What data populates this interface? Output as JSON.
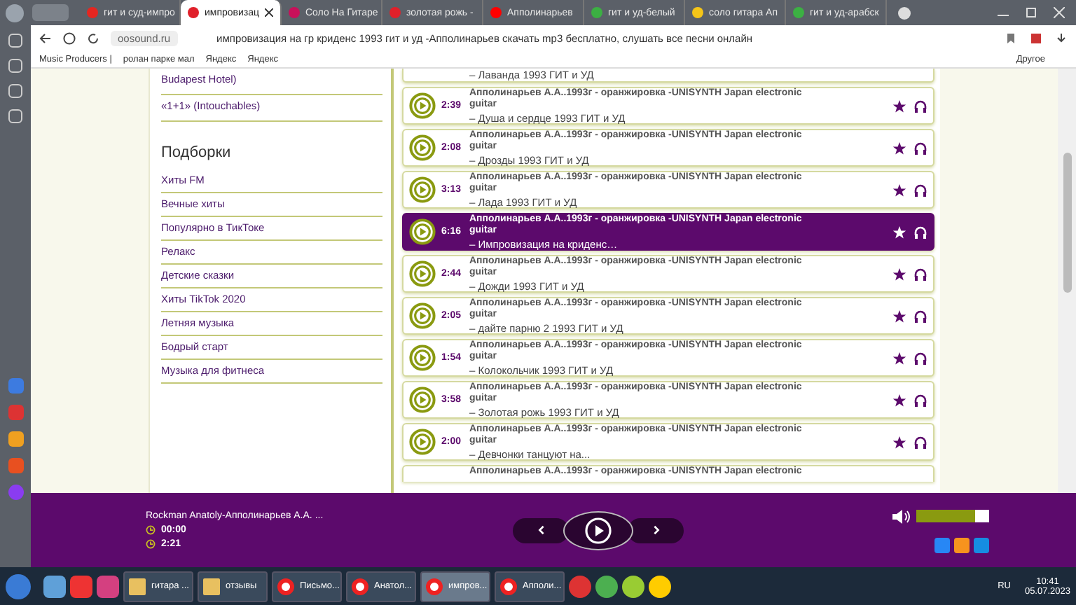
{
  "browser": {
    "tabs": [
      {
        "label": "гит и суд-импро",
        "selected": false,
        "color": "#e52620"
      },
      {
        "label": "импровизац",
        "selected": true,
        "color": "#e0202a"
      },
      {
        "label": "Соло На Гитаре",
        "selected": false,
        "color": "#c8105a"
      },
      {
        "label": "золотая рожь -",
        "selected": false,
        "color": "#e0202a"
      },
      {
        "label": "Апполинарьев",
        "selected": false,
        "color": "#ff0000"
      },
      {
        "label": "гит и уд-белый",
        "selected": false,
        "color": "#3cb043"
      },
      {
        "label": "соло гитара Ап",
        "selected": false,
        "color": "#f5c518"
      },
      {
        "label": "гит и уд-арабск",
        "selected": false,
        "color": "#3cb043"
      }
    ],
    "address": "oosound.ru",
    "page_title": "импровизация на гр криденс 1993 гит и уд -Апполинарьев скачать mp3 бесплатно, слушать все песни онлайн",
    "bookmarks": [
      "Music Producers |",
      "ролан парке мал",
      "Яндекс",
      "Яндекс"
    ],
    "bookmarks_other": "Другое"
  },
  "sidebar": {
    "film_items": [
      "Budapest Hotel)",
      "«1+1» (Intouchables)"
    ],
    "heading": "Подборки",
    "items": [
      "Хиты FM",
      "Вечные хиты",
      "Популярно в ТикТоке",
      "Релакс",
      "Детские сказки",
      "Хиты TikTok 2020",
      "Летняя музыка",
      "Бодрый старт",
      "Музыка для фитнеса"
    ]
  },
  "tracks": [
    {
      "kind": "tail",
      "subtitle": "– Лаванда 1993 ГИТ и УД"
    },
    {
      "kind": "full",
      "selected": false,
      "duration": "2:39",
      "title": "Апполинарьев А.А..1993г - оранжировка -UNISYNTH Japan electronic guitar",
      "subtitle": "– Душа и сердце 1993 ГИТ и УД"
    },
    {
      "kind": "full",
      "selected": false,
      "duration": "2:08",
      "title": "Апполинарьев А.А..1993г - оранжировка -UNISYNTH Japan electronic guitar",
      "subtitle": "– Дрозды 1993 ГИТ и УД"
    },
    {
      "kind": "full",
      "selected": false,
      "duration": "3:13",
      "title": "Апполинарьев А.А..1993г - оранжировка -UNISYNTH Japan electronic guitar",
      "subtitle": "– Лада 1993 ГИТ и УД"
    },
    {
      "kind": "full",
      "selected": true,
      "duration": "6:16",
      "title": "Апполинарьев А.А..1993г - оранжировка -UNISYNTH Japan electronic guitar",
      "subtitle": "– Импровизация на криденс…"
    },
    {
      "kind": "full",
      "selected": false,
      "duration": "2:44",
      "title": "Апполинарьев А.А..1993г - оранжировка -UNISYNTH Japan electronic guitar",
      "subtitle": "– Дожди 1993 ГИТ и УД"
    },
    {
      "kind": "full",
      "selected": false,
      "duration": "2:05",
      "title": "Апполинарьев А.А..1993г - оранжировка -UNISYNTH Japan electronic guitar",
      "subtitle": "– дайте парню 2 1993 ГИТ и УД"
    },
    {
      "kind": "full",
      "selected": false,
      "duration": "1:54",
      "title": "Апполинарьев А.А..1993г - оранжировка -UNISYNTH Japan electronic guitar",
      "subtitle": "– Колокольчик 1993 ГИТ и УД"
    },
    {
      "kind": "full",
      "selected": false,
      "duration": "3:58",
      "title": "Апполинарьев А.А..1993г - оранжировка -UNISYNTH Japan electronic guitar",
      "subtitle": "– Золотая рожь 1993 ГИТ и УД"
    },
    {
      "kind": "full",
      "selected": false,
      "duration": "2:00",
      "title": "Апполинарьев А.А..1993г - оранжировка -UNISYNTH Japan electronic guitar",
      "subtitle": "– Девчонки танцуют на..."
    },
    {
      "kind": "head",
      "title": "Апполинарьев А.А..1993г - оранжировка -UNISYNTH Japan electronic"
    }
  ],
  "player": {
    "track": "Rockman Anatoly-Апполинарьев А.А. ...",
    "elapsed": "00:00",
    "total": "2:21",
    "volume": {
      "level": 0.8
    }
  },
  "taskbar": {
    "buttons": [
      {
        "label": "гитара ...",
        "selected": false,
        "kind": "folder"
      },
      {
        "label": "отзывы",
        "selected": false,
        "kind": "folder"
      },
      {
        "label": "Письмо...",
        "selected": false,
        "kind": "browser"
      },
      {
        "label": "Анатол...",
        "selected": false,
        "kind": "browser"
      },
      {
        "label": "импров...",
        "selected": true,
        "kind": "browser"
      },
      {
        "label": "Апполи...",
        "selected": false,
        "kind": "browser"
      }
    ],
    "language": "RU",
    "time": "10:41",
    "date": "05.07.2023"
  }
}
